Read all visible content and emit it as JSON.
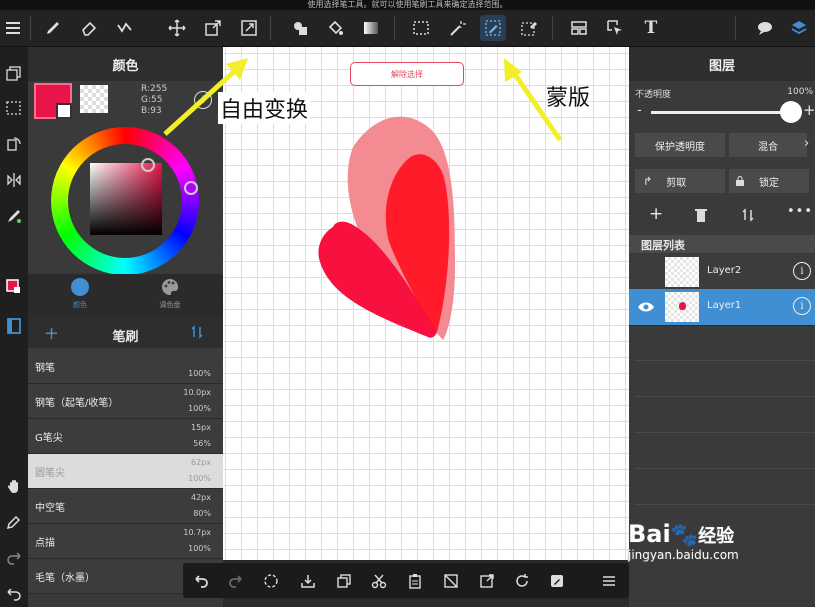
{
  "status_bar": {
    "message": "使用选择笔工具。就可以使用笔刷工具来确定选择范围。"
  },
  "toolbar": {
    "tools": [
      {
        "icon": "menu-icon"
      },
      {
        "icon": "brush-icon"
      },
      {
        "icon": "eraser-icon"
      },
      {
        "icon": "stabilizer-icon"
      },
      {
        "icon": "move-icon"
      },
      {
        "icon": "transform-icon"
      },
      {
        "icon": "free-transform-icon"
      },
      {
        "icon": "shape-fill-icon"
      },
      {
        "icon": "bucket-icon"
      },
      {
        "icon": "gradient-icon"
      },
      {
        "icon": "select-rect-icon"
      },
      {
        "icon": "magic-wand-icon"
      },
      {
        "icon": "select-pen-icon"
      },
      {
        "icon": "select-eraser-icon"
      },
      {
        "icon": "layout-icon"
      },
      {
        "icon": "select-layer-icon"
      },
      {
        "icon": "text-icon"
      },
      {
        "icon": "speech-bubble-icon"
      },
      {
        "icon": "layers-icon"
      }
    ],
    "text_tool_glyph": "T"
  },
  "color_panel": {
    "title": "颜色",
    "r": "R:255",
    "g": "G:55",
    "b": "B:93",
    "primary_color": "#e8154a",
    "tab_color": "颜色",
    "tab_palette": "调色盘"
  },
  "brush_panel": {
    "title": "笔刷",
    "brushes": [
      {
        "name": "钢笔",
        "size": "",
        "opacity": "100%"
      },
      {
        "name": "钢笔（起笔/收笔）",
        "size": "10.0px",
        "opacity": "100%"
      },
      {
        "name": "G笔尖",
        "size": "15px",
        "opacity": "56%"
      },
      {
        "name": "圆笔尖",
        "size": "62px",
        "opacity": "100%"
      },
      {
        "name": "中空笔",
        "size": "42px",
        "opacity": "80%"
      },
      {
        "name": "点描",
        "size": "10.7px",
        "opacity": "100%"
      },
      {
        "name": "毛笔（水墨）",
        "size": "",
        "opacity": ""
      }
    ]
  },
  "canvas": {
    "deselect_button": "解除选择"
  },
  "annotations": {
    "free_transform": "自由变换",
    "mask": "蒙版"
  },
  "layer_panel": {
    "title": "图层",
    "opacity_label": "不透明度",
    "opacity_value": "100%",
    "opacity_fraction": 1.0,
    "protect_alpha": "保护透明度",
    "blend": "混合",
    "clip": "剪取",
    "lock": "锁定",
    "list_title": "图层列表",
    "layers": [
      {
        "name": "Layer2",
        "selected": false
      },
      {
        "name": "Layer1",
        "selected": true
      }
    ]
  },
  "watermark": {
    "brand": "Bai",
    "brand2": "经验",
    "url": "jingyan.baidu.com"
  },
  "colors": {
    "accent": "#3f8fd2",
    "red": "#e8154a",
    "pink": "#f48a92"
  }
}
